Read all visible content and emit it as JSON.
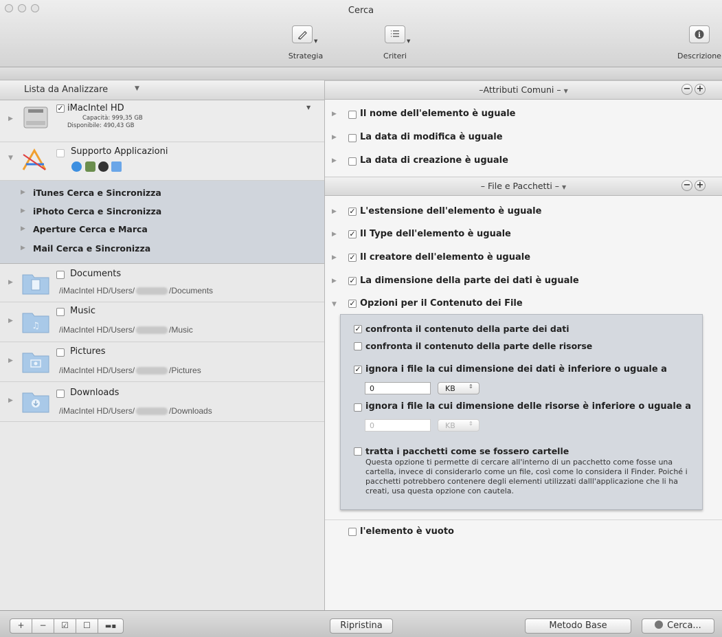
{
  "window": {
    "title": "Cerca"
  },
  "toolbar": {
    "strategy_label": "Strategia",
    "criteria_label": "Criteri",
    "description_label": "Descrizione"
  },
  "left_panel": {
    "header": "Lista da Analizzare",
    "volume": {
      "name": "iMacIntel HD",
      "checked": true,
      "capacity": "Capacità: 999,35 GB",
      "available": "Disponibile: 490,43 GB"
    },
    "app_support": {
      "label": "Supporto Applicazioni",
      "checked": false
    },
    "app_items": [
      {
        "label": "iTunes Cerca e Sincronizza"
      },
      {
        "label": "iPhoto Cerca e Sincronizza"
      },
      {
        "label": "Aperture Cerca e Marca"
      },
      {
        "label": "Mail Cerca e Sincronizza"
      }
    ],
    "folders": [
      {
        "name": "Documents",
        "path_prefix": "/iMacIntel HD/Users/",
        "path_suffix": "/Documents",
        "checked": false
      },
      {
        "name": "Music",
        "path_prefix": "/iMacIntel HD/Users/",
        "path_suffix": "/Music",
        "checked": false
      },
      {
        "name": "Pictures",
        "path_prefix": "/iMacIntel HD/Users/",
        "path_suffix": "/Pictures",
        "checked": false
      },
      {
        "name": "Downloads",
        "path_prefix": "/iMacIntel HD/Users/",
        "path_suffix": "/Downloads",
        "checked": false
      }
    ]
  },
  "right_panel": {
    "group1": {
      "header": "–Attributi Comuni –",
      "items": [
        {
          "label": "Il nome dell'elemento è uguale",
          "checked": false
        },
        {
          "label": "La data di modifica è uguale",
          "checked": false
        },
        {
          "label": "La data di creazione è uguale",
          "checked": false
        }
      ]
    },
    "group2": {
      "header": "– File e Pacchetti –",
      "items": [
        {
          "label": "L'estensione dell'elemento è uguale",
          "checked": true
        },
        {
          "label": "Il Type dell'elemento è uguale",
          "checked": true
        },
        {
          "label": "Il creatore dell'elemento è uguale",
          "checked": true
        },
        {
          "label": "La dimensione della parte dei dati è uguale",
          "checked": true
        },
        {
          "label": "Opzioni per il Contenuto dei File",
          "checked": true,
          "expanded": true
        }
      ]
    },
    "options": {
      "compare_data": {
        "label": "confronta il contenuto della parte dei dati",
        "checked": true
      },
      "compare_resources": {
        "label": "confronta il contenuto della parte delle risorse",
        "checked": false
      },
      "ignore_data": {
        "label": "ignora i file la cui dimensione dei dati è inferiore o uguale a",
        "checked": true,
        "value": "0",
        "unit": "KB"
      },
      "ignore_resources": {
        "label": "ignora i file la cui dimensione delle risorse è inferiore o uguale a",
        "checked": false,
        "value": "0",
        "unit": "KB"
      },
      "packages": {
        "label": "tratta i pacchetti come se fossero cartelle",
        "checked": false,
        "description": "Questa opzione ti permette di cercare all'interno di un pacchetto come fosse una cartella, invece di considerarlo come un file, così come lo considera il Finder. Poiché i pacchetti potrebbero contenere degli elementi utilizzati dalll'applicazione che li ha creati, usa questa opzione con cautela."
      }
    },
    "empty_item": {
      "label": "l'elemento è vuoto",
      "checked": false
    }
  },
  "bottom_bar": {
    "reset_label": "Ripristina",
    "basic_method_label": "Metodo Base",
    "search_label": "Cerca..."
  }
}
